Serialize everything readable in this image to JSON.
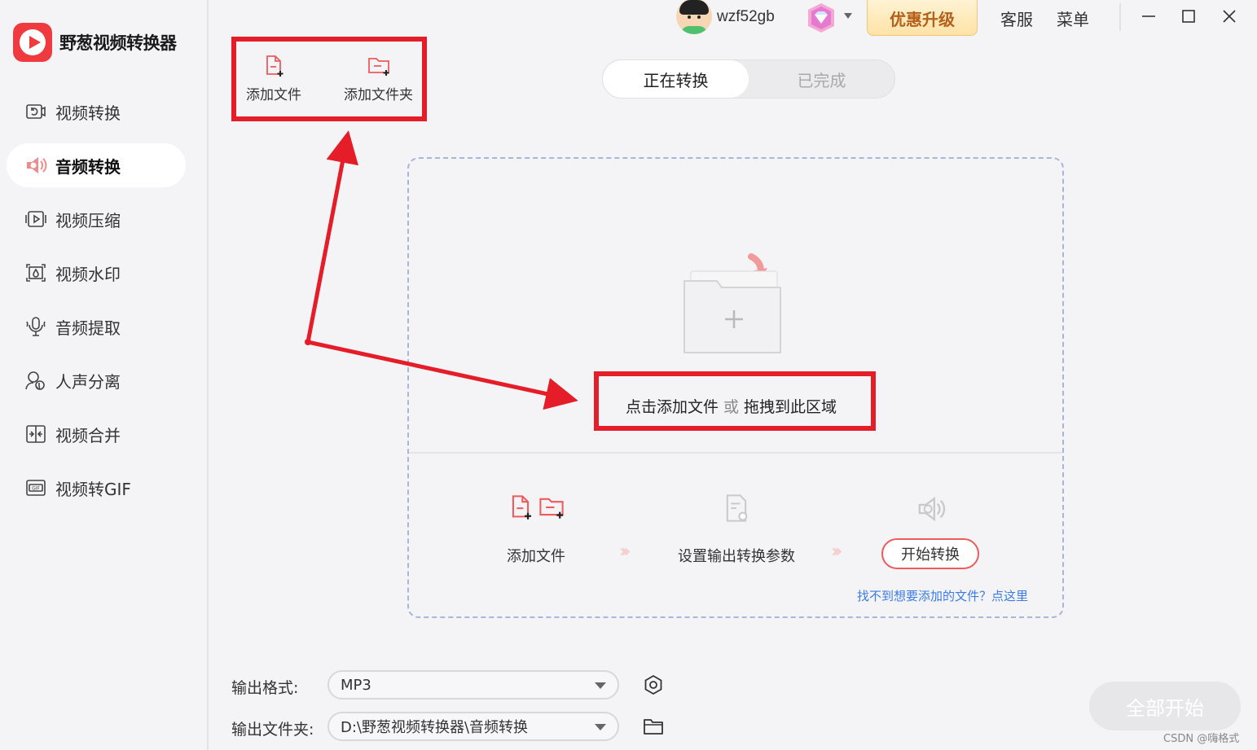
{
  "app": {
    "title": "野葱视频转换器"
  },
  "sidebar": {
    "items": [
      {
        "label": "视频转换",
        "icon": "video-convert-icon",
        "active": false
      },
      {
        "label": "音频转换",
        "icon": "audio-convert-icon",
        "active": true
      },
      {
        "label": "视频压缩",
        "icon": "video-compress-icon",
        "active": false
      },
      {
        "label": "视频水印",
        "icon": "video-watermark-icon",
        "active": false
      },
      {
        "label": "音频提取",
        "icon": "audio-extract-icon",
        "active": false
      },
      {
        "label": "人声分离",
        "icon": "voice-separate-icon",
        "active": false
      },
      {
        "label": "视频合并",
        "icon": "video-merge-icon",
        "active": false
      },
      {
        "label": "视频转GIF",
        "icon": "video-gif-icon",
        "active": false
      }
    ]
  },
  "topbar": {
    "username": "wzf52gb",
    "upgrade_label": "优惠升级",
    "service_label": "客服",
    "menu_label": "菜单"
  },
  "toolbar": {
    "add_file_label": "添加文件",
    "add_folder_label": "添加文件夹"
  },
  "tabs": [
    {
      "label": "正在转换",
      "active": true
    },
    {
      "label": "已完成",
      "active": false
    }
  ],
  "dropzone": {
    "hint_main": "点击添加文件",
    "hint_or": "或",
    "hint_drag": "拖拽到此区域",
    "steps": {
      "add_file": "添加文件",
      "set_params": "设置输出转换参数",
      "start_convert": "开始转换"
    },
    "help_link": "找不到想要添加的文件？点这里"
  },
  "output": {
    "format_label": "输出格式:",
    "format_value": "MP3",
    "folder_label": "输出文件夹:",
    "folder_value": "D:\\野葱视频转换器\\音频转换"
  },
  "start_all_label": "全部开始",
  "watermark": "CSDN @嗨格式",
  "colors": {
    "brand_red": "#ef3b3f",
    "annotation_red": "#e51d29",
    "link_blue": "#3b7bea",
    "upgrade_gold": "#b5601a"
  }
}
